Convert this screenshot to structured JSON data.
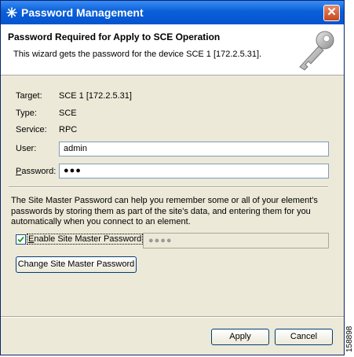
{
  "window": {
    "title": "Password Management",
    "close_label": "✕"
  },
  "banner": {
    "title": "Password Required for Apply to SCE Operation",
    "description": "This wizard gets the password for the device SCE 1 [172.2.5.31]."
  },
  "details": {
    "target_label": "Target:",
    "target_value": "SCE 1 [172.2.5.31]",
    "type_label": "Type:",
    "type_value": "SCE",
    "service_label": "Service:",
    "service_value": "RPC"
  },
  "form": {
    "user_label": "User:",
    "user_value": "admin",
    "password_label_underlined": "P",
    "password_label_rest": "assword:",
    "password_value": "●●●"
  },
  "master": {
    "info": "The Site Master Password can help you remember some or all of your element's passwords by storing them as part of the site's data, and entering them for you automatically when you connect to an element.",
    "enable_label_underlined": "E",
    "enable_label_rest": "nable Site Master Password",
    "enable_checked": true,
    "master_password_value": "●●●●",
    "change_button": "Change Site Master Password"
  },
  "footer": {
    "apply_button": "Apply",
    "cancel_button": "Cancel"
  },
  "figure_number": "158898"
}
